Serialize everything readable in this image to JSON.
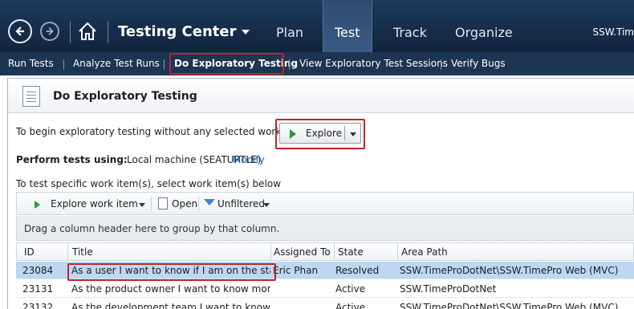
{
  "topbar": {
    "app_title": "Testing Center",
    "tabs": [
      {
        "label": "Plan"
      },
      {
        "label": "Test"
      },
      {
        "label": "Track"
      },
      {
        "label": "Organize"
      }
    ],
    "user": "SSW.Tim",
    "colors": {
      "bar": "#1d3a5c",
      "active_tab": "#3b5b85"
    }
  },
  "subnav": {
    "items": [
      {
        "label": "Run Tests"
      },
      {
        "label": "Analyze Test Runs"
      },
      {
        "label": "Do Exploratory Testing"
      },
      {
        "label": "View Exploratory Test Sessions"
      },
      {
        "label": "Verify Bugs"
      }
    ],
    "active_index": 2
  },
  "panel": {
    "title": "Do Exploratory Testing",
    "begin_text": "To begin exploratory testing without any selected work items:",
    "explore_label": "Explore",
    "perform_label": "Perform tests using:",
    "perform_value": "Local machine (SEATURTLE)",
    "modify_link": "Modify",
    "specific_text": "To test specific work item(s), select work item(s) below"
  },
  "toolbar": {
    "explore_item_label": "Explore work item",
    "open_label": "Open",
    "filter_label": "Unfiltered"
  },
  "group_hint": "Drag a column header here to group by that column.",
  "grid": {
    "columns": [
      "ID",
      "Title",
      "Assigned To",
      "State",
      "Area Path"
    ],
    "rows": [
      {
        "id": "23084",
        "title": "As a user I want to know if I am on the stagin...",
        "assigned": "Eric Phan",
        "state": "Resolved",
        "area": "SSW.TimeProDotNet\\SSW.TimePro Web (MVC)"
      },
      {
        "id": "23131",
        "title": "As the product owner I want to know more a...",
        "assigned": "",
        "state": "Active",
        "area": "SSW.TimeProDotNet"
      },
      {
        "id": "23132",
        "title": "As the development team I want to know m...",
        "assigned": "",
        "state": "Active",
        "area": "SSW.TimeProDotNet\\SSW.TimePro Web (MVC)"
      }
    ],
    "selected_index": 0
  }
}
